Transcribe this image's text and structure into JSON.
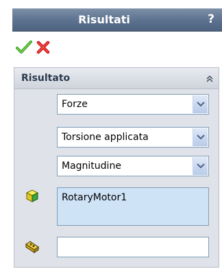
{
  "window": {
    "title": "Risultati",
    "help_label": "?"
  },
  "actions": {
    "ok_icon": "checkmark-icon",
    "cancel_icon": "x-icon",
    "ok_color": "#3aa11c",
    "cancel_color": "#d8141a"
  },
  "group": {
    "title": "Risultato",
    "collapse_icon": "double-chevron-up-icon",
    "dropdowns": [
      {
        "value": "Forze"
      },
      {
        "value": "Torsione applicata"
      },
      {
        "value": "Magnitudine"
      }
    ],
    "component_list": {
      "icon": "part-cube-icon",
      "items": [
        "RotaryMotor1"
      ]
    },
    "reference": {
      "icon": "reference-component-icon",
      "value": ""
    }
  },
  "colors": {
    "titlebar": "#5e7390",
    "group_bg": "#dfe2e8",
    "list_selection_bg": "#cfe3f7",
    "field_border": "#7f9db9"
  }
}
